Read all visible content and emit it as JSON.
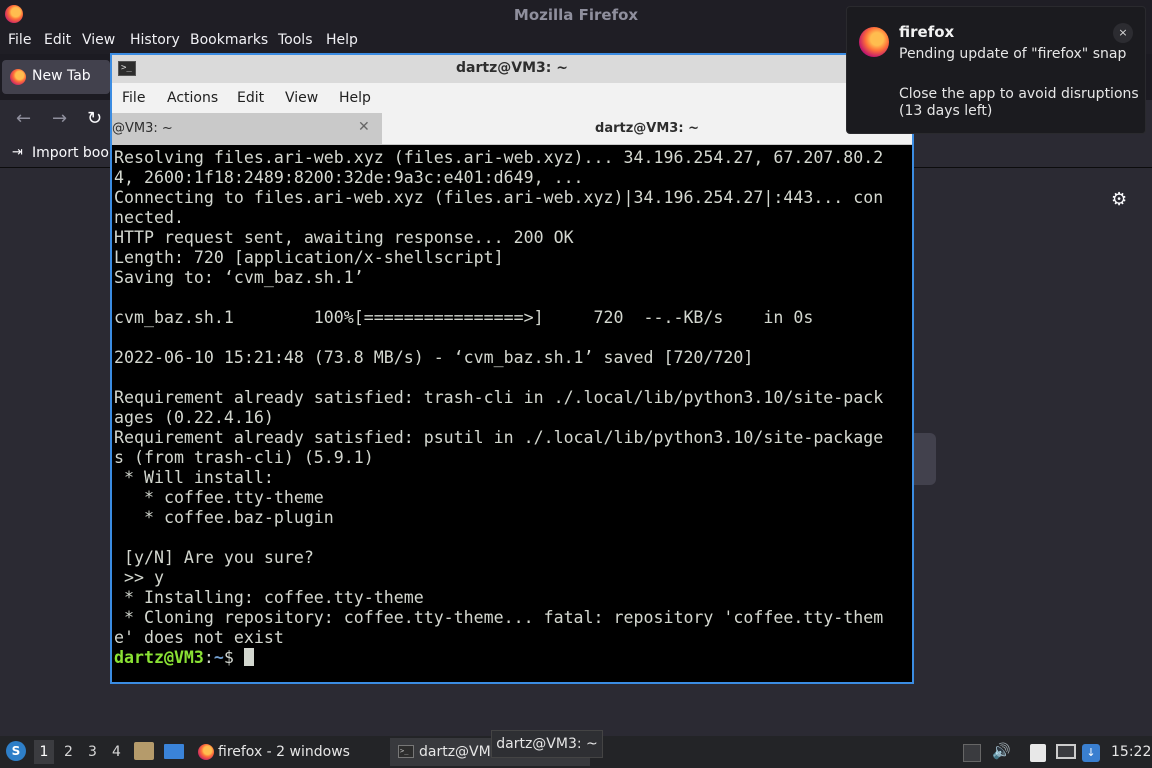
{
  "firefox": {
    "title": "Mozilla Firefox",
    "menu": [
      "File",
      "Edit",
      "View",
      "History",
      "Bookmarks",
      "Tools",
      "Help"
    ],
    "tab_label": "New Tab",
    "bookmark_label": "Import book"
  },
  "terminal": {
    "title": "dartz@VM3: ~",
    "menu": [
      "File",
      "Actions",
      "Edit",
      "View",
      "Help"
    ],
    "tabs": [
      "@VM3: ~",
      "dartz@VM3: ~"
    ],
    "output": "Resolving files.ari-web.xyz (files.ari-web.xyz)... 34.196.254.27, 67.207.80.2\n4, 2600:1f18:2489:8200:32de:9a3c:e401:d649, ...\nConnecting to files.ari-web.xyz (files.ari-web.xyz)|34.196.254.27|:443... con\nnected.\nHTTP request sent, awaiting response... 200 OK\nLength: 720 [application/x-shellscript]\nSaving to: ‘cvm_baz.sh.1’\n\ncvm_baz.sh.1        100%[================>]     720  --.-KB/s    in 0s\n\n2022-06-10 15:21:48 (73.8 MB/s) - ‘cvm_baz.sh.1’ saved [720/720]\n\nRequirement already satisfied: trash-cli in ./.local/lib/python3.10/site-pack\nages (0.22.4.16)\nRequirement already satisfied: psutil in ./.local/lib/python3.10/site-package\ns (from trash-cli) (5.9.1)\n * Will install:\n   * coffee.tty-theme\n   * coffee.baz-plugin\n\n [y/N] Are you sure?\n >> y\n * Installing: coffee.tty-theme\n * Cloning repository: coffee.tty-theme... fatal: repository 'coffee.tty-them\ne' does not exist",
    "prompt_user": "dartz@VM3",
    "prompt_sep": ":",
    "prompt_path": "~",
    "prompt_symbol": "$ "
  },
  "notification": {
    "app": "firefox",
    "line1": "Pending update of \"firefox\" snap",
    "line2": "Close the app to avoid disruptions (13 days left)",
    "close_glyph": "×"
  },
  "taskbar": {
    "workspaces": [
      "1",
      "2",
      "3",
      "4"
    ],
    "firefox_item": "firefox - 2 windows",
    "terminal_item": "dartz@VM",
    "tooltip": "dartz@VM3: ~",
    "clock": "15:22"
  },
  "colors": {
    "terminal_border": "#3b8ce2",
    "prompt_user": "#8ae234",
    "prompt_path": "#729fcf"
  }
}
